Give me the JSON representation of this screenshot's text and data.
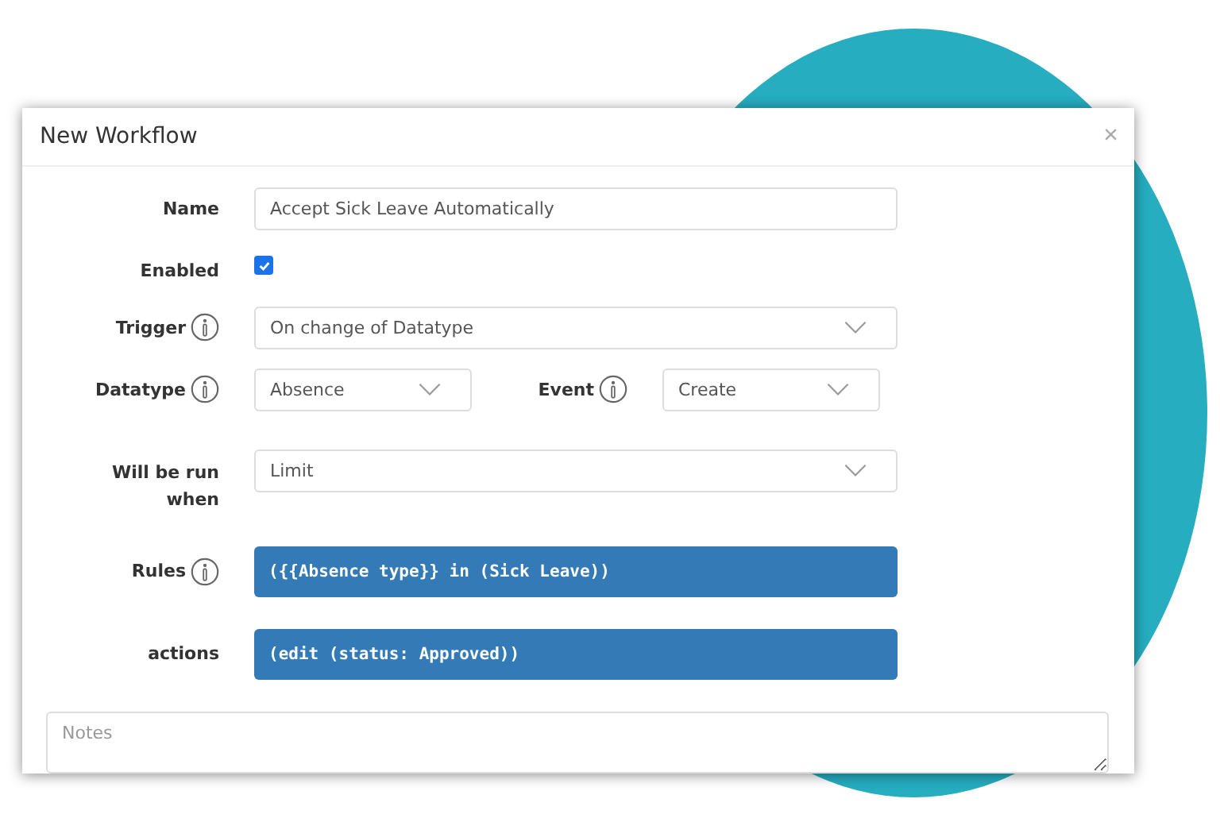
{
  "window": {
    "title": "New Workflow",
    "close": "×"
  },
  "rows": [
    {
      "kind": "text",
      "label": "Name",
      "info": false,
      "value": "Accept Sick Leave Automatically"
    },
    {
      "kind": "checkbox",
      "label": "Enabled",
      "info": false,
      "checked": true
    },
    {
      "kind": "select",
      "label": "Trigger",
      "info": true,
      "value": "On change of Datatype"
    },
    {
      "kind": "pair",
      "label": "Datatype",
      "info": true,
      "value": "Absence",
      "label_2": "Event",
      "info_2": true,
      "value_2": "Create"
    },
    {
      "kind": "select",
      "label": "Will be run when",
      "info": false,
      "value": "Limit"
    },
    {
      "kind": "code",
      "label": "Rules",
      "info": true,
      "value": "({{Absence type}} in (Sick Leave))"
    },
    {
      "kind": "code",
      "label": "actions",
      "info": false,
      "value": "(edit (status: Approved))"
    }
  ],
  "notes": {
    "placeholder": "Notes"
  }
}
